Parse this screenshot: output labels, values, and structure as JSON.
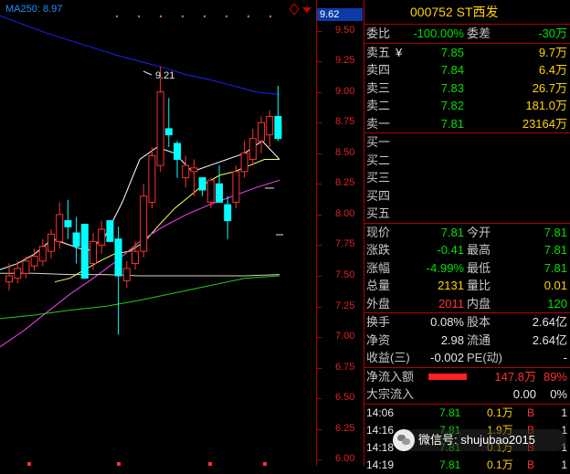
{
  "chart": {
    "ma_label": "MA250: 8.97",
    "high_annotation": "9.21",
    "current_price_tag": "9.62",
    "y_ticks": [
      "9.50",
      "9.25",
      "9.00",
      "8.75",
      "8.50",
      "8.25",
      "8.00",
      "7.75",
      "7.50",
      "7.25",
      "7.00",
      "6.75",
      "6.50",
      "6.25",
      "6.00"
    ],
    "colors": {
      "up": "#ff3030",
      "down": "#00ffff",
      "ma_white": "#ffffff",
      "ma_yellow": "#ffff66",
      "ma_magenta": "#ff44ff",
      "ma_green": "#22cc22",
      "ma250": "#2020ff"
    }
  },
  "chart_data": {
    "type": "candlestick",
    "ylim": [
      5.95,
      9.75
    ],
    "candles": [
      {
        "o": 7.45,
        "h": 7.6,
        "l": 7.38,
        "c": 7.5
      },
      {
        "o": 7.48,
        "h": 7.62,
        "l": 7.44,
        "c": 7.56
      },
      {
        "o": 7.52,
        "h": 7.66,
        "l": 7.48,
        "c": 7.62
      },
      {
        "o": 7.58,
        "h": 7.72,
        "l": 7.54,
        "c": 7.66
      },
      {
        "o": 7.62,
        "h": 7.8,
        "l": 7.58,
        "c": 7.74
      },
      {
        "o": 7.7,
        "h": 7.88,
        "l": 7.64,
        "c": 7.84
      },
      {
        "o": 7.78,
        "h": 8.1,
        "l": 7.72,
        "c": 8.0
      },
      {
        "o": 7.95,
        "h": 8.12,
        "l": 7.8,
        "c": 7.9
      },
      {
        "o": 7.85,
        "h": 7.98,
        "l": 7.6,
        "c": 7.74
      },
      {
        "o": 7.92,
        "h": 7.92,
        "l": 7.48,
        "c": 7.48
      },
      {
        "o": 7.6,
        "h": 7.85,
        "l": 7.55,
        "c": 7.78
      },
      {
        "o": 7.75,
        "h": 7.95,
        "l": 7.68,
        "c": 7.88
      },
      {
        "o": 7.95,
        "h": 7.95,
        "l": 7.78,
        "c": 7.78
      },
      {
        "o": 7.8,
        "h": 7.9,
        "l": 7.02,
        "c": 7.5
      },
      {
        "o": 7.46,
        "h": 7.62,
        "l": 7.4,
        "c": 7.56
      },
      {
        "o": 7.6,
        "h": 7.78,
        "l": 7.55,
        "c": 7.7
      },
      {
        "o": 7.7,
        "h": 8.25,
        "l": 7.65,
        "c": 8.15
      },
      {
        "o": 8.1,
        "h": 8.55,
        "l": 8.05,
        "c": 8.48
      },
      {
        "o": 8.4,
        "h": 9.21,
        "l": 8.35,
        "c": 9.0
      },
      {
        "o": 8.7,
        "h": 8.95,
        "l": 8.55,
        "c": 8.65
      },
      {
        "o": 8.58,
        "h": 8.6,
        "l": 8.3,
        "c": 8.45
      },
      {
        "o": 8.3,
        "h": 8.48,
        "l": 8.22,
        "c": 8.4
      },
      {
        "o": 8.35,
        "h": 8.45,
        "l": 8.15,
        "c": 8.38
      },
      {
        "o": 8.3,
        "h": 8.3,
        "l": 8.15,
        "c": 8.2
      },
      {
        "o": 8.1,
        "h": 8.3,
        "l": 8.05,
        "c": 8.28
      },
      {
        "o": 8.25,
        "h": 8.4,
        "l": 8.2,
        "c": 8.1
      },
      {
        "o": 8.08,
        "h": 8.15,
        "l": 7.8,
        "c": 7.95
      },
      {
        "o": 8.1,
        "h": 8.4,
        "l": 8.05,
        "c": 8.35
      },
      {
        "o": 8.35,
        "h": 8.6,
        "l": 8.3,
        "c": 8.5
      },
      {
        "o": 8.45,
        "h": 8.7,
        "l": 8.4,
        "c": 8.62
      },
      {
        "o": 8.6,
        "h": 8.8,
        "l": 8.5,
        "c": 8.75
      },
      {
        "o": 8.65,
        "h": 8.85,
        "l": 8.55,
        "c": 8.8
      },
      {
        "o": 8.8,
        "h": 9.05,
        "l": 8.6,
        "c": 8.62
      }
    ],
    "ma_lines": [
      {
        "name": "MA250",
        "values": [
          9.62,
          9.55,
          9.48,
          9.42,
          9.36,
          9.3,
          9.25,
          9.2,
          9.14,
          9.1,
          9.05,
          9.0,
          8.98
        ]
      },
      {
        "name": "white",
        "values": [
          7.55,
          7.6,
          7.68,
          7.8,
          7.75,
          7.7,
          7.82,
          8.1,
          8.45,
          8.55,
          8.5,
          8.35,
          8.4,
          8.45,
          8.5,
          8.6,
          8.45
        ]
      },
      {
        "name": "yellow",
        "values": [
          7.45,
          7.48,
          7.55,
          7.62,
          7.68,
          7.7,
          7.78,
          7.92,
          8.05,
          8.15,
          8.25,
          8.32,
          8.35,
          8.4,
          8.45,
          8.45
        ]
      },
      {
        "name": "magenta",
        "values": [
          6.92,
          7.05,
          7.2,
          7.35,
          7.48,
          7.62,
          7.78,
          7.9,
          8.0,
          8.08,
          8.15,
          8.22,
          8.28
        ]
      },
      {
        "name": "green",
        "values": [
          7.15,
          7.18,
          7.22,
          7.25,
          7.3,
          7.36,
          7.42,
          7.48,
          7.5
        ]
      },
      {
        "name": "gray",
        "values": [
          7.52,
          7.52,
          7.51,
          7.51,
          7.5,
          7.5,
          7.5,
          7.5,
          7.51
        ]
      }
    ]
  },
  "quote": {
    "code_name": "000752 ST西发",
    "weibi_label": "委比",
    "weibi_value": "-100.00%",
    "weicha_label": "委差",
    "weicha_value": "-30万",
    "asks": [
      {
        "label": "卖五",
        "flag": "¥",
        "price": "7.85",
        "vol": "9.7万"
      },
      {
        "label": "卖四",
        "flag": "",
        "price": "7.84",
        "vol": "6.4万"
      },
      {
        "label": "卖三",
        "flag": "",
        "price": "7.83",
        "vol": "26.7万"
      },
      {
        "label": "卖二",
        "flag": "",
        "price": "7.82",
        "vol": "181.0万"
      },
      {
        "label": "卖一",
        "flag": "",
        "price": "7.81",
        "vol": "23164万"
      }
    ],
    "bids": [
      "买一",
      "买二",
      "买三",
      "买四",
      "买五"
    ],
    "stats": [
      {
        "l1": "现价",
        "v1": "7.81",
        "l2": "今开",
        "v2": "7.81"
      },
      {
        "l1": "涨跌",
        "v1": "-0.41",
        "l2": "最高",
        "v2": "7.81"
      },
      {
        "l1": "涨幅",
        "v1": "-4.99%",
        "l2": "最低",
        "v2": "7.81"
      },
      {
        "l1": "总量",
        "v1": "2131",
        "l2": "量比",
        "v2": "0.01"
      },
      {
        "l1": "外盘",
        "v1": "2011",
        "l2": "内盘",
        "v2": "120"
      }
    ],
    "fund": [
      {
        "l1": "换手",
        "v1": "0.08%",
        "l2": "股本",
        "v2": "2.64亿"
      },
      {
        "l1": "净资",
        "v1": "2.98",
        "l2": "流通",
        "v2": "2.64亿"
      },
      {
        "l1": "收益(三)",
        "v1": "-0.002",
        "l2": "PE(动)",
        "v2": "-"
      }
    ],
    "flow": [
      {
        "label": "净流入额",
        "value": "147.8万",
        "pct": "89%"
      },
      {
        "label": "大宗流入",
        "value": "0.00",
        "pct": "0%"
      }
    ],
    "trades": [
      {
        "time": "14:06",
        "price": "7.81",
        "vol": "0.1万",
        "bs": "B",
        "n": "1"
      },
      {
        "time": "14:16",
        "price": "7.81",
        "vol": "1.9万",
        "bs": "B",
        "n": "1"
      },
      {
        "time": "14:18",
        "price": "7.81",
        "vol": "0.1万",
        "bs": "B",
        "n": "1"
      },
      {
        "time": "14:19",
        "price": "7.81",
        "vol": "0.1万",
        "bs": "B",
        "n": "1"
      }
    ]
  },
  "watermark": {
    "text": "微信号: shujubao2015"
  }
}
